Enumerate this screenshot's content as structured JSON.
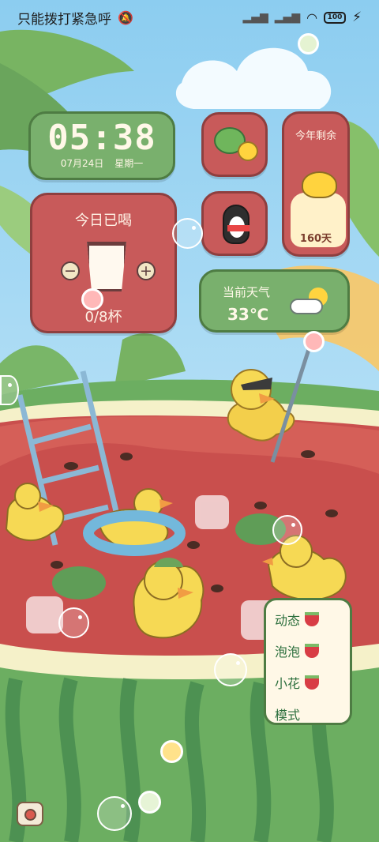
{
  "status_bar": {
    "carrier": "只能拨打紧急呼",
    "battery": "100"
  },
  "clock_widget": {
    "time": "05:38",
    "date": "07月24日",
    "weekday": "星期一"
  },
  "water_widget": {
    "title": "今日已喝",
    "minus": "−",
    "plus": "+",
    "count": "0/8杯"
  },
  "countdown_widget": {
    "title": "今年剩余",
    "days": "160天"
  },
  "weather_widget": {
    "title": "当前天气",
    "temperature": "33℃"
  },
  "menu": {
    "items": [
      "动态",
      "泡泡",
      "小花",
      "模式"
    ]
  },
  "icons": {
    "mute": "bell-muted-icon",
    "signal": "signal-icon",
    "wifi": "wifi-icon",
    "camera": "camera-icon",
    "weather": "partly-sunny-icon",
    "chat_app": "wechat-like-icon",
    "penguin_app": "penguin-icon"
  },
  "colors": {
    "sky": "#9fd3ef",
    "widget_green": "#79b06d",
    "widget_red": "#c85a5a",
    "menu_text": "#2c6f3d"
  }
}
